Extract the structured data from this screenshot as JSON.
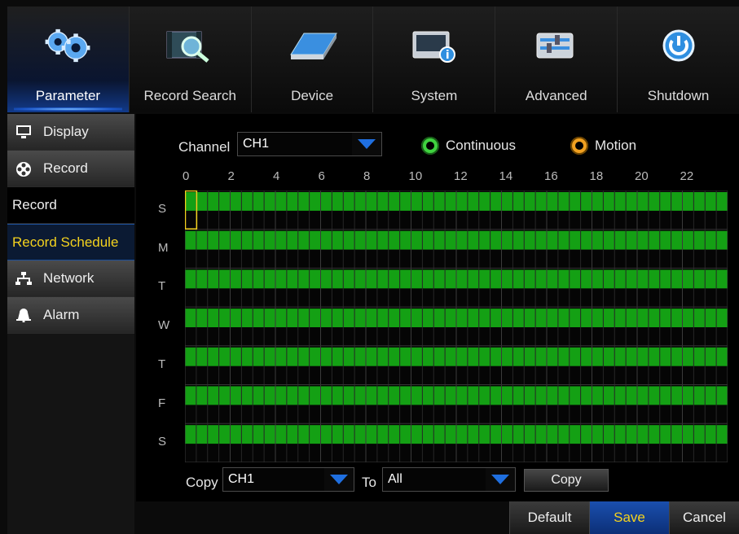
{
  "colors": {
    "accent_blue": "#1f5fd6",
    "schedule_green": "#14a014",
    "highlight_yellow": "#f4d21e",
    "continuous_green": "#3fd23f",
    "motion_orange": "#f0a020"
  },
  "topnav": {
    "tabs": [
      {
        "label": "Parameter",
        "icon": "gears-icon",
        "active": true
      },
      {
        "label": "Record Search",
        "icon": "search-film-icon",
        "active": false
      },
      {
        "label": "Device",
        "icon": "hdd-icon",
        "active": false
      },
      {
        "label": "System",
        "icon": "system-info-icon",
        "active": false
      },
      {
        "label": "Advanced",
        "icon": "sliders-icon",
        "active": false
      },
      {
        "label": "Shutdown",
        "icon": "power-icon",
        "active": false
      }
    ]
  },
  "sidebar": {
    "display": "Display",
    "record": "Record",
    "record_sub": "Record",
    "record_schedule": "Record Schedule",
    "network": "Network",
    "alarm": "Alarm"
  },
  "schedule": {
    "channel_label": "Channel",
    "channel_value": "CH1",
    "legend_continuous": "Continuous",
    "legend_motion": "Motion",
    "hour_labels": [
      "0",
      "2",
      "4",
      "6",
      "8",
      "10",
      "12",
      "14",
      "16",
      "18",
      "20",
      "22"
    ],
    "days": [
      "S",
      "M",
      "T",
      "W",
      "T",
      "F",
      "S"
    ],
    "recording_fraction_per_day": [
      1,
      1,
      1,
      1,
      1,
      1,
      1
    ],
    "mode": "Continuous"
  },
  "copy": {
    "copy_label": "Copy",
    "from_value": "CH1",
    "to_label": "To",
    "to_value": "All",
    "copy_button": "Copy"
  },
  "footer": {
    "default": "Default",
    "save": "Save",
    "cancel": "Cancel"
  }
}
